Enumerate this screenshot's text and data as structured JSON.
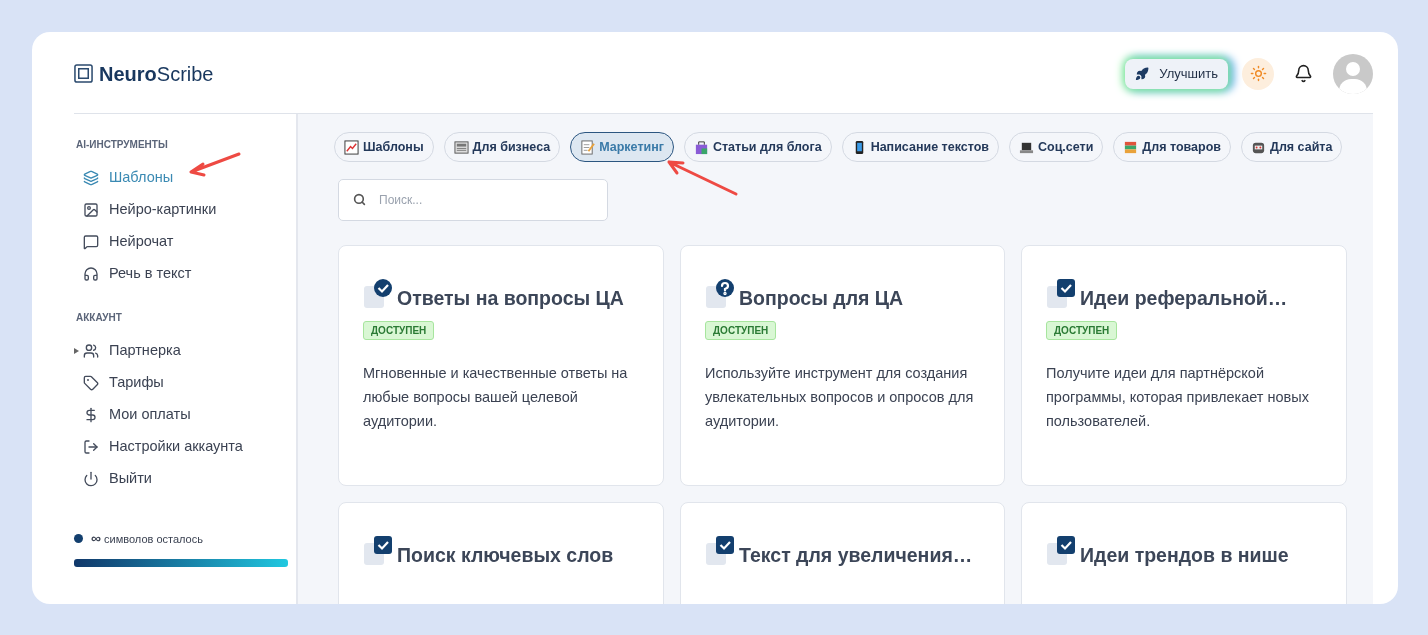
{
  "brand": {
    "bold": "Neuro",
    "light": "Scribe"
  },
  "header": {
    "upgrade": "Улучшить"
  },
  "sidebar": {
    "sections": [
      {
        "title": "AI-ИНСТРУМЕНТЫ",
        "items": [
          {
            "label": "Шаблоны",
            "selected": true
          },
          {
            "label": "Нейро-картинки",
            "selected": false
          },
          {
            "label": "Нейрочат",
            "selected": false
          },
          {
            "label": "Речь в текст",
            "selected": false
          }
        ]
      },
      {
        "title": "АККАУНТ",
        "items": [
          {
            "label": "Партнерка",
            "selected": false,
            "expanded": false
          },
          {
            "label": "Тарифы",
            "selected": false
          },
          {
            "label": "Мои оплаты",
            "selected": false
          },
          {
            "label": "Настройки аккаунта",
            "selected": false
          },
          {
            "label": "Выйти",
            "selected": false
          }
        ]
      }
    ],
    "symbols": {
      "count": "∞",
      "label": "символов осталось"
    }
  },
  "categories": [
    {
      "label": "Шаблоны",
      "selected": false
    },
    {
      "label": "Для бизнеса",
      "selected": false
    },
    {
      "label": "Маркетинг",
      "selected": true
    },
    {
      "label": "Статьи для блога",
      "selected": false
    },
    {
      "label": "Написание текстов",
      "selected": false
    },
    {
      "label": "Соц.сети",
      "selected": false
    },
    {
      "label": "Для товаров",
      "selected": false
    },
    {
      "label": "Для сайта",
      "selected": false
    }
  ],
  "search": {
    "placeholder": "Поиск..."
  },
  "cards": [
    {
      "title": "Ответы на вопросы ЦА",
      "badge": "ДОСТУПЕН",
      "description": "Мгновенные и качественные ответы на любые вопросы вашей целевой аудитории."
    },
    {
      "title": "Вопросы для ЦА",
      "badge": "ДОСТУПЕН",
      "description": "Используйте инструмент для создания увлекательных вопросов и опросов для аудитории."
    },
    {
      "title": "Идеи реферальной…",
      "badge": "ДОСТУПЕН",
      "description": "Получите идеи для партнёрской программы, которая привлекает новых пользователей."
    },
    {
      "title": "Поиск ключевых слов"
    },
    {
      "title": "Текст для увеличения…"
    },
    {
      "title": "Идеи трендов в нише"
    }
  ]
}
